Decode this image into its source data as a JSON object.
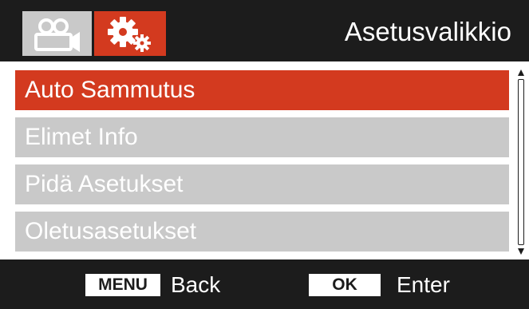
{
  "header": {
    "title": "Asetusvalikkio",
    "tabs": [
      {
        "icon": "video-camera-icon",
        "active": false
      },
      {
        "icon": "gears-icon",
        "active": true
      }
    ]
  },
  "menu": {
    "items": [
      {
        "label": "Auto Sammutus",
        "selected": true
      },
      {
        "label": "Elimet Info",
        "selected": false
      },
      {
        "label": "Pidä Asetukset",
        "selected": false
      },
      {
        "label": "Oletusasetukset",
        "selected": false
      }
    ]
  },
  "footer": {
    "menu_key": "MENU",
    "menu_action": "Back",
    "ok_key": "OK",
    "ok_action": "Enter"
  },
  "colors": {
    "accent": "#d33a1f",
    "inactive": "#c9c9c9",
    "bar": "#1c1c1c"
  }
}
